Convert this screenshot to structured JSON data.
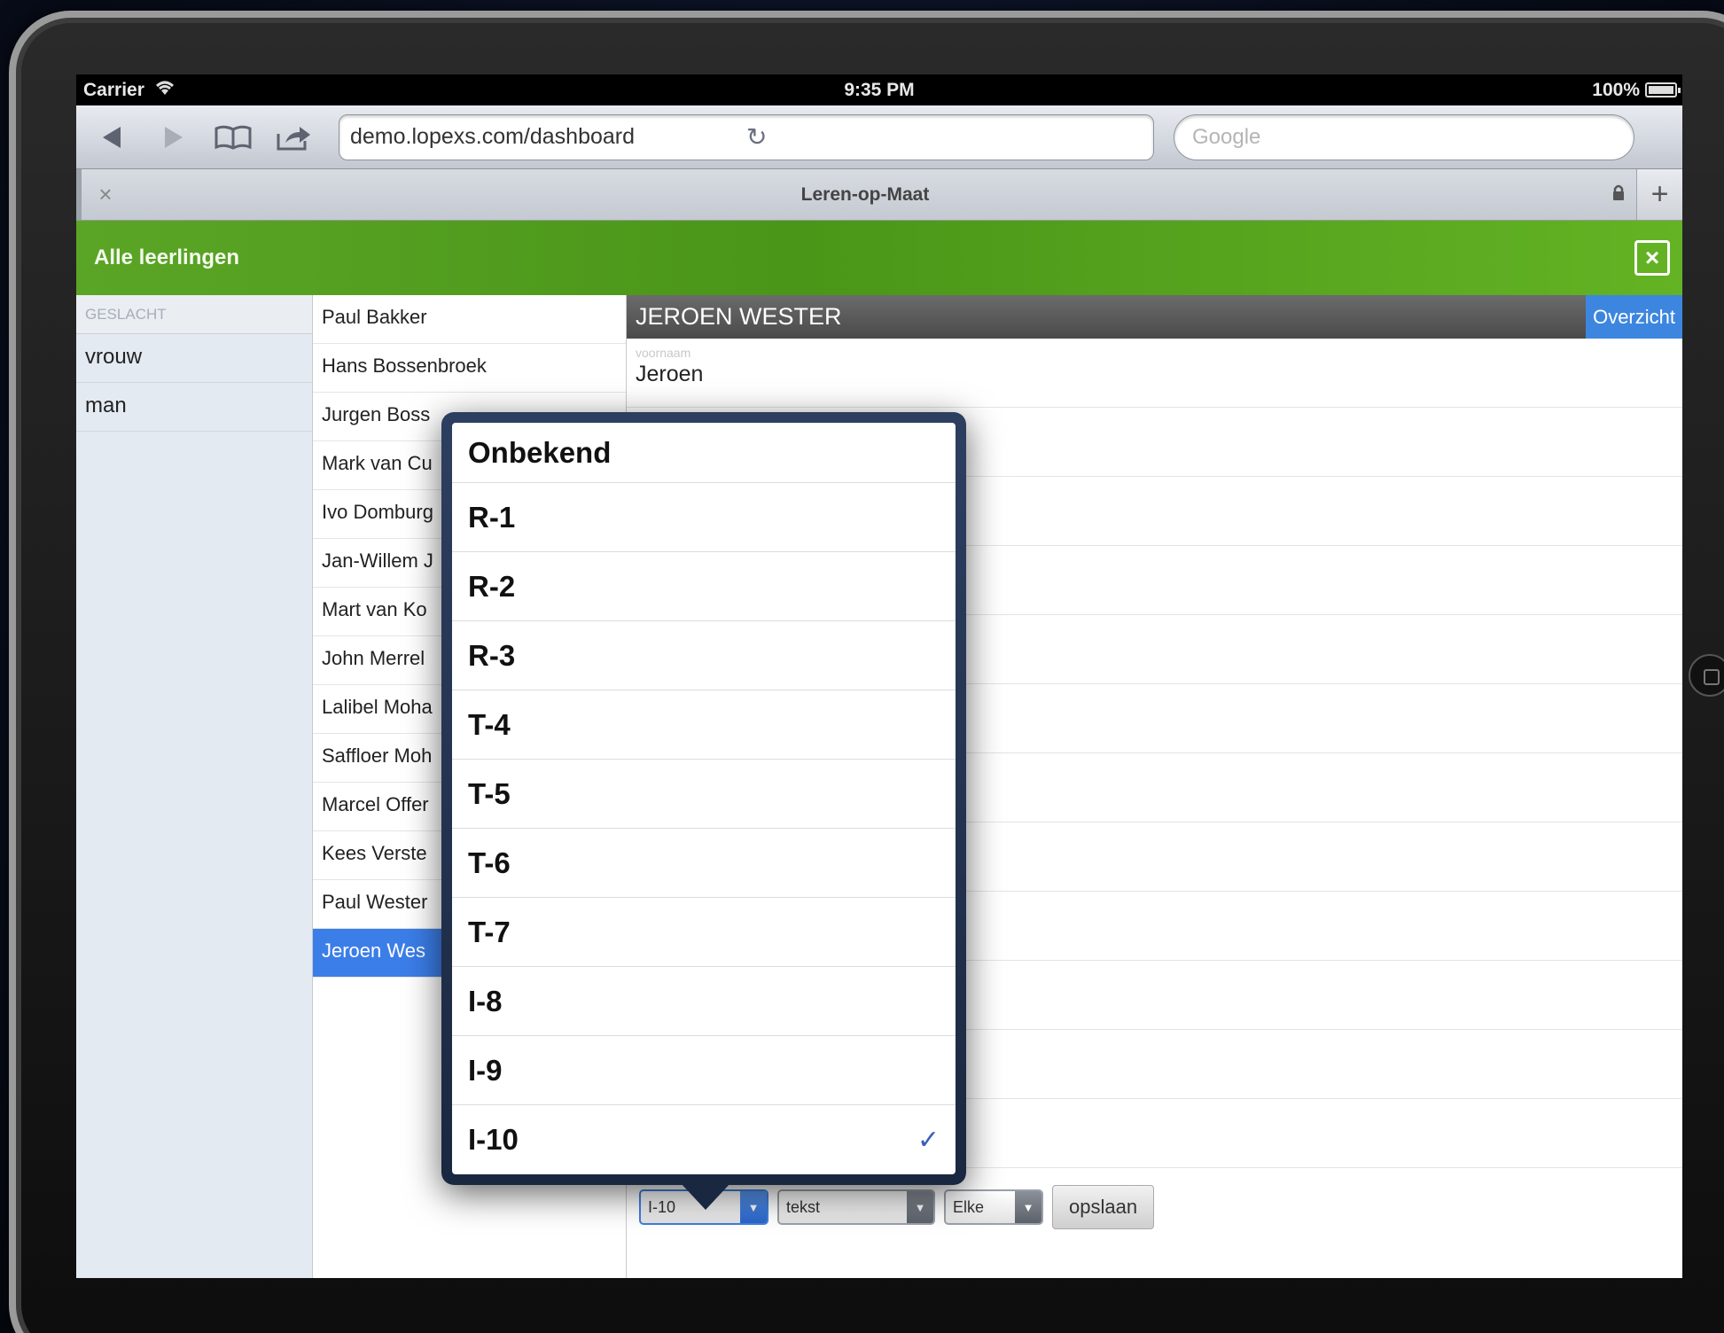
{
  "status": {
    "carrier": "Carrier",
    "time": "9:35 PM",
    "battery": "100%"
  },
  "browser": {
    "url": "demo.lopexs.com/dashboard",
    "search_placeholder": "Google",
    "tab_title": "Leren-op-Maat"
  },
  "header": {
    "title": "Alle leerlingen"
  },
  "filters": {
    "heading": "GESLACHT",
    "items": [
      "vrouw",
      "man"
    ]
  },
  "students": [
    "Paul Bakker",
    "Hans Bossenbroek",
    "Jurgen Boss",
    "Mark van Cu",
    "Ivo Domburg",
    "Jan-Willem J",
    "Mart van Ko",
    "John Merrel",
    "Lalibel Moha",
    "Saffloer Moh",
    "Marcel Offer",
    "Kees Verste",
    "Paul Wester",
    "Jeroen Wes"
  ],
  "detail": {
    "name": "JEROEN WESTER",
    "overview_label": "Overzicht",
    "field_label": "voornaam",
    "field_value": "Jeroen"
  },
  "controls": {
    "level_value": "I-10",
    "type_value": "tekst",
    "freq_value": "Elke",
    "save_label": "opslaan"
  },
  "picker": {
    "options": [
      "Onbekend",
      "R-1",
      "R-2",
      "R-3",
      "T-4",
      "T-5",
      "T-6",
      "T-7",
      "I-8",
      "I-9",
      "I-10"
    ],
    "selected": "I-10"
  }
}
